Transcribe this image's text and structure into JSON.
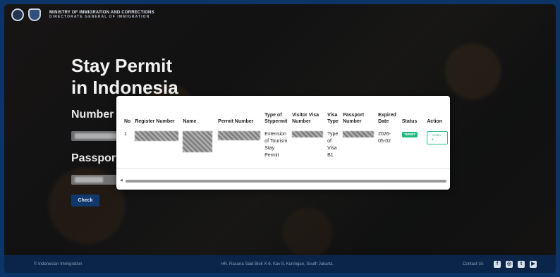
{
  "header": {
    "ministry": "MINISTRY OF IMMIGRATION AND CORRECTIONS",
    "directorate": "DIRECTORATE GENERAL OF IMMIGRATION"
  },
  "hero": {
    "title_line1": "Stay Permit",
    "title_line2": "in Indonesia",
    "number_label": "Number",
    "passport_label": "Passport",
    "check_label": "Check"
  },
  "table": {
    "headers": {
      "no": "No",
      "register_number": "Register Number",
      "name": "Name",
      "permit_number": "Permit Number",
      "type_of_stypermit": "Type of Stypermit",
      "visitor_visa_number": "Visitor Visa Number",
      "visa_type": "Visa Type",
      "passport_number": "Passport Number",
      "expired_date": "Expired Date",
      "status": "Status",
      "action": "Action"
    },
    "row": {
      "no": "1",
      "type_of_stypermit": "Extension of Tourism Stay Permit",
      "visa_type": "Type of Visa B1",
      "expired_date": "2026-05-02",
      "status": "TERBIT",
      "action": "Action ▾"
    }
  },
  "footer": {
    "copyright": "© Indonesian Immigration",
    "address": "HR. Rasuna Said Blok X-6, Kav 8, Kuningan, South Jakarta.",
    "contact": "Contact Us"
  },
  "colors": {
    "status_badge": "#1db97a",
    "action_border": "#2bbf87",
    "check_button": "#10386a",
    "footer_bg": "#0a2548"
  }
}
